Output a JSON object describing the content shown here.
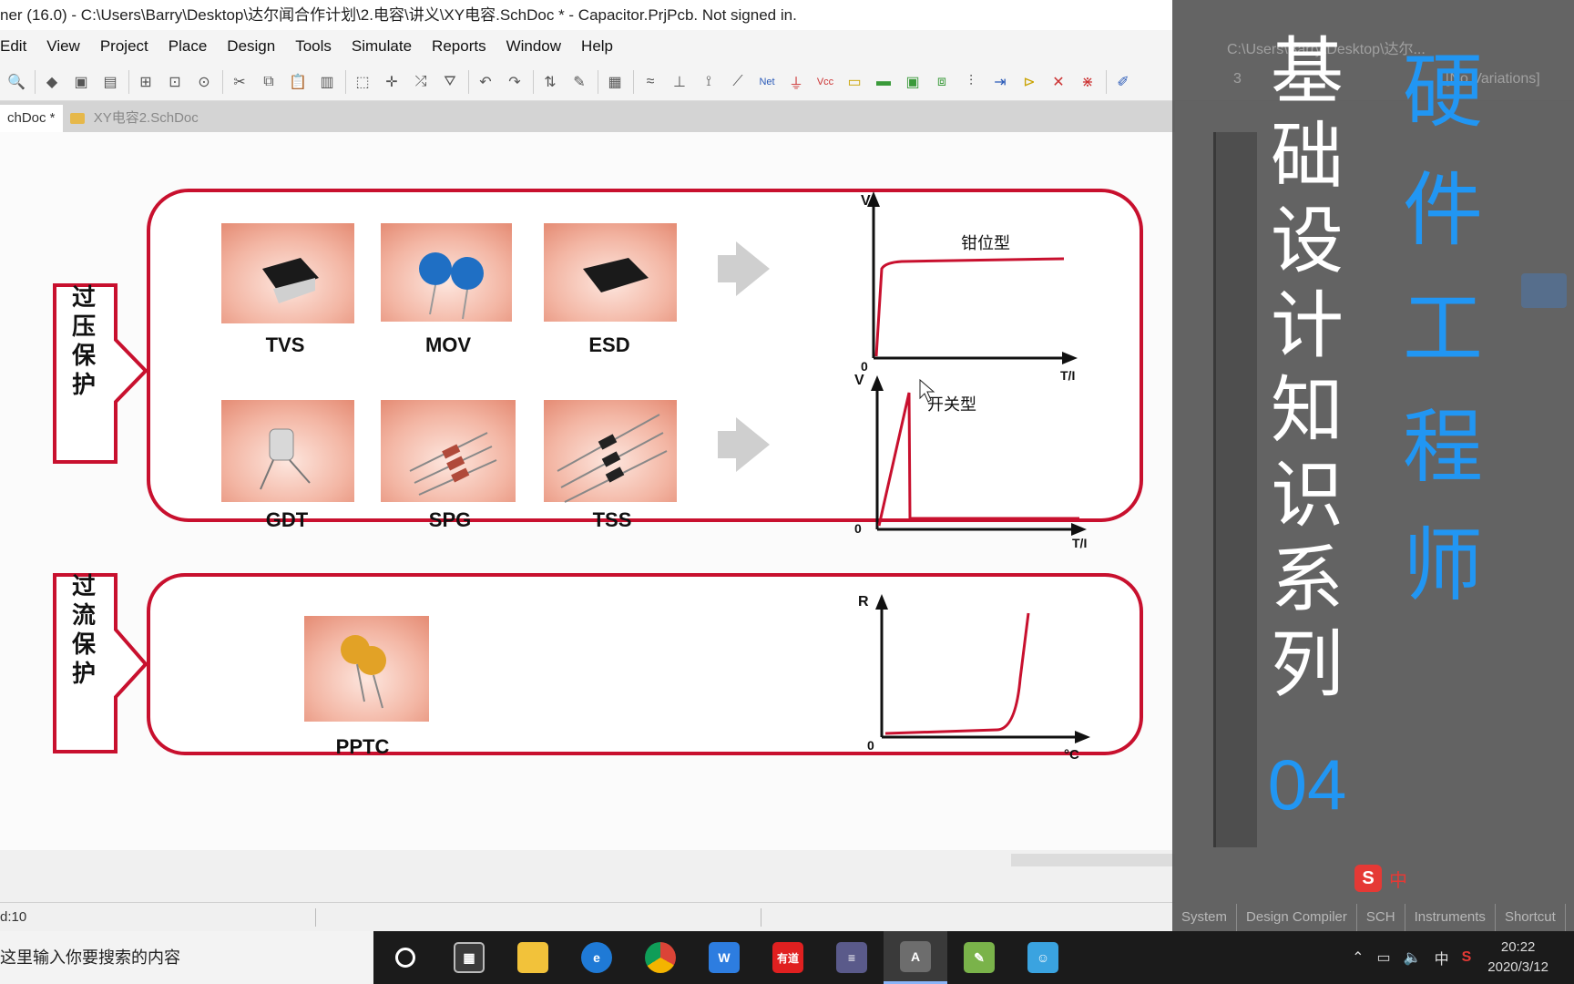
{
  "window": {
    "title": "ner (16.0) - C:\\Users\\Barry\\Desktop\\达尔闻合作计划\\2.电容\\讲义\\XY电容.SchDoc * - Capacitor.PrjPcb. Not signed in."
  },
  "menu": [
    "Edit",
    "View",
    "Project",
    "Place",
    "Design",
    "Tools",
    "Simulate",
    "Reports",
    "Window",
    "Help"
  ],
  "toolbar_right": {
    "path": "C:\\Users\\Barry\\Desktop\\达尔...",
    "width_value": "3",
    "variations": "[No Variations]"
  },
  "tabs": [
    {
      "label": "chDoc *",
      "active": true
    },
    {
      "label": "XY电容2.SchDoc",
      "active": false
    }
  ],
  "diagram": {
    "overvoltage_label": "过压保护",
    "overcurrent_label": "过流保护",
    "row1": [
      "TVS",
      "MOV",
      "ESD"
    ],
    "row2": [
      "GDT",
      "SPG",
      "TSS"
    ],
    "row3": [
      "PPTC"
    ],
    "graphs": {
      "clamp": {
        "y_label": "V",
        "x_label": "T/I",
        "origin": "0",
        "caption": "钳位型"
      },
      "switch": {
        "y_label": "V",
        "x_label": "T/I",
        "origin": "0",
        "caption": "开关型"
      },
      "pptc": {
        "y_label": "R",
        "x_label": "°C",
        "origin": "0"
      }
    }
  },
  "status": {
    "grid": "d:10"
  },
  "overlay": {
    "title_white": [
      "基",
      "础",
      "设",
      "计",
      "知",
      "识",
      "系",
      "列"
    ],
    "series_number": "04",
    "title_blue": [
      "硬",
      "件",
      "工",
      "程",
      "师"
    ],
    "bottom_tabs": [
      "System",
      "Design Compiler",
      "SCH",
      "Instruments",
      "Shortcut"
    ]
  },
  "taskbar": {
    "search_placeholder": "这里输入你要搜索的内容",
    "clock_time": "20:22",
    "clock_date": "2020/3/12",
    "ime": "中"
  },
  "colors": {
    "frame_red": "#c8102e",
    "overlay_bg": "#5a5a5a",
    "accent_blue": "#2196f3"
  }
}
